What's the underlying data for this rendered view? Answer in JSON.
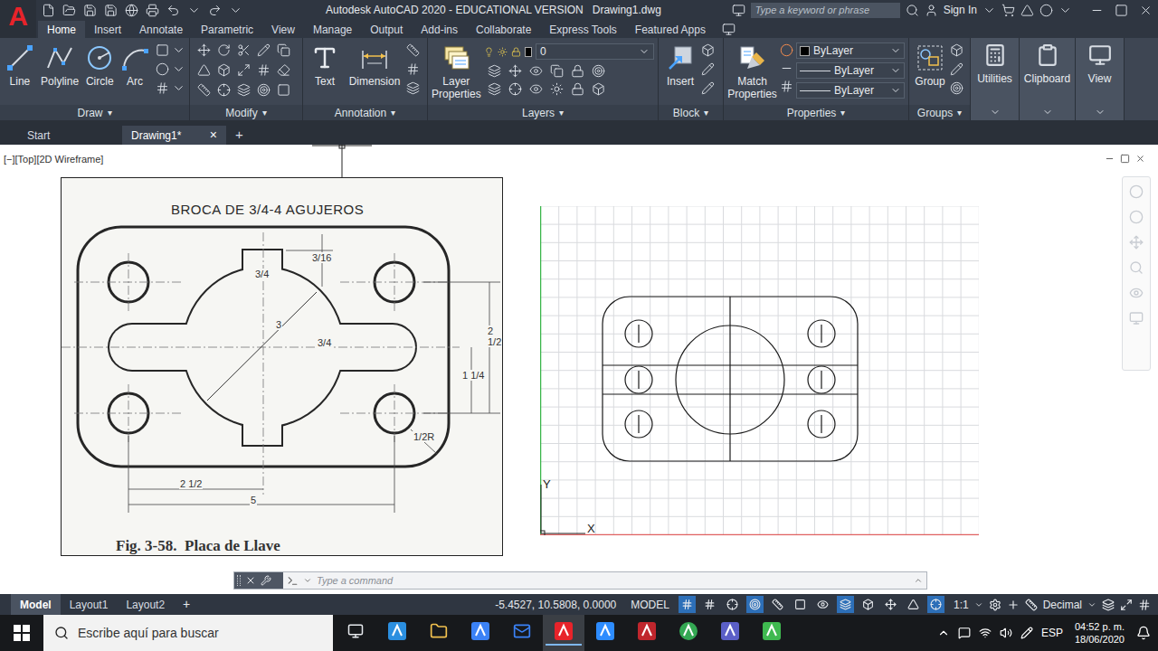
{
  "window": {
    "logo": "A",
    "title": "Autodesk AutoCAD 2020 - EDUCATIONAL VERSION",
    "file": "Drawing1.dwg"
  },
  "search": {
    "placeholder": "Type a keyword or phrase"
  },
  "account": {
    "label": "Sign In"
  },
  "ribbon_tabs": [
    {
      "label": "Home",
      "selected": true
    },
    {
      "label": "Insert",
      "selected": false
    },
    {
      "label": "Annotate",
      "selected": false
    },
    {
      "label": "Parametric",
      "selected": false
    },
    {
      "label": "View",
      "selected": false
    },
    {
      "label": "Manage",
      "selected": false
    },
    {
      "label": "Output",
      "selected": false
    },
    {
      "label": "Add-ins",
      "selected": false
    },
    {
      "label": "Collaborate",
      "selected": false
    },
    {
      "label": "Express Tools",
      "selected": false
    },
    {
      "label": "Featured Apps",
      "selected": false
    }
  ],
  "ribbon": {
    "draw": {
      "title": "Draw",
      "arrow": "▾",
      "buttons": [
        "Line",
        "Polyline",
        "Circle",
        "Arc"
      ]
    },
    "modify": {
      "title": "Modify",
      "arrow": "▾"
    },
    "annotation": {
      "title": "Annotation",
      "arrow": "▾",
      "buttons": [
        "Text",
        "Dimension"
      ]
    },
    "layers": {
      "title": "Layers",
      "arrow": "▾",
      "button": "Layer Properties",
      "current_layer": "0"
    },
    "block": {
      "title": "Block",
      "arrow": "▾",
      "button": "Insert"
    },
    "properties": {
      "title": "Properties",
      "arrow": "▾",
      "button": "Match Properties",
      "color": "ByLayer",
      "linetype": "ByLayer",
      "lineweight": "ByLayer"
    },
    "groups": {
      "title": "Groups",
      "arrow": "▾",
      "button": "Group"
    },
    "collapsed": [
      {
        "label": "Utilities"
      },
      {
        "label": "Clipboard"
      },
      {
        "label": "View"
      }
    ]
  },
  "file_tabs": [
    {
      "label": "Start",
      "selected": false,
      "closable": false
    },
    {
      "label": "Drawing1*",
      "selected": true,
      "closable": true
    }
  ],
  "file_tab_close": "×",
  "new_tab": "+",
  "viewport": {
    "label": "[−][Top][2D Wireframe]"
  },
  "reference_figure": {
    "title": "BROCA DE 3/4-4 AGUJEROS",
    "caption": "Fig. 3-58.  Placa de Llave",
    "dimensions": [
      "3/16",
      "3/4",
      "3",
      "3/4",
      "2 1/2",
      "1 1/4",
      "1/2R",
      "2 1/2",
      "5"
    ]
  },
  "ucs": {
    "x": "X",
    "y": "Y"
  },
  "command_line": {
    "placeholder": "Type a command"
  },
  "status_bar": {
    "layout_tabs": [
      {
        "label": "Model",
        "selected": true
      },
      {
        "label": "Layout1",
        "selected": false
      },
      {
        "label": "Layout2",
        "selected": false
      }
    ],
    "add": "+",
    "coordinates": "-5.4527, 10.5808, 0.0000",
    "space": "MODEL",
    "toggles": [
      {
        "on": true
      },
      {
        "on": false
      },
      {
        "on": false
      },
      {
        "on": true
      },
      {
        "on": false
      },
      {
        "on": false
      },
      {
        "on": false
      },
      {
        "on": true
      },
      {
        "on": false
      },
      {
        "on": false
      },
      {
        "on": false
      },
      {
        "on": true
      }
    ],
    "scale": "1:1",
    "units": "Decimal"
  },
  "taskbar": {
    "search_placeholder": "Escribe aquí para buscar",
    "apps": [
      {
        "active": false
      },
      {
        "active": false
      },
      {
        "active": false
      },
      {
        "active": false
      },
      {
        "active": false
      },
      {
        "active": true
      },
      {
        "active": false
      },
      {
        "active": false
      },
      {
        "active": false
      },
      {
        "active": false
      },
      {
        "active": false
      }
    ],
    "language": "ESP",
    "time": "04:52 p. m.",
    "date": "18/06/2020"
  }
}
